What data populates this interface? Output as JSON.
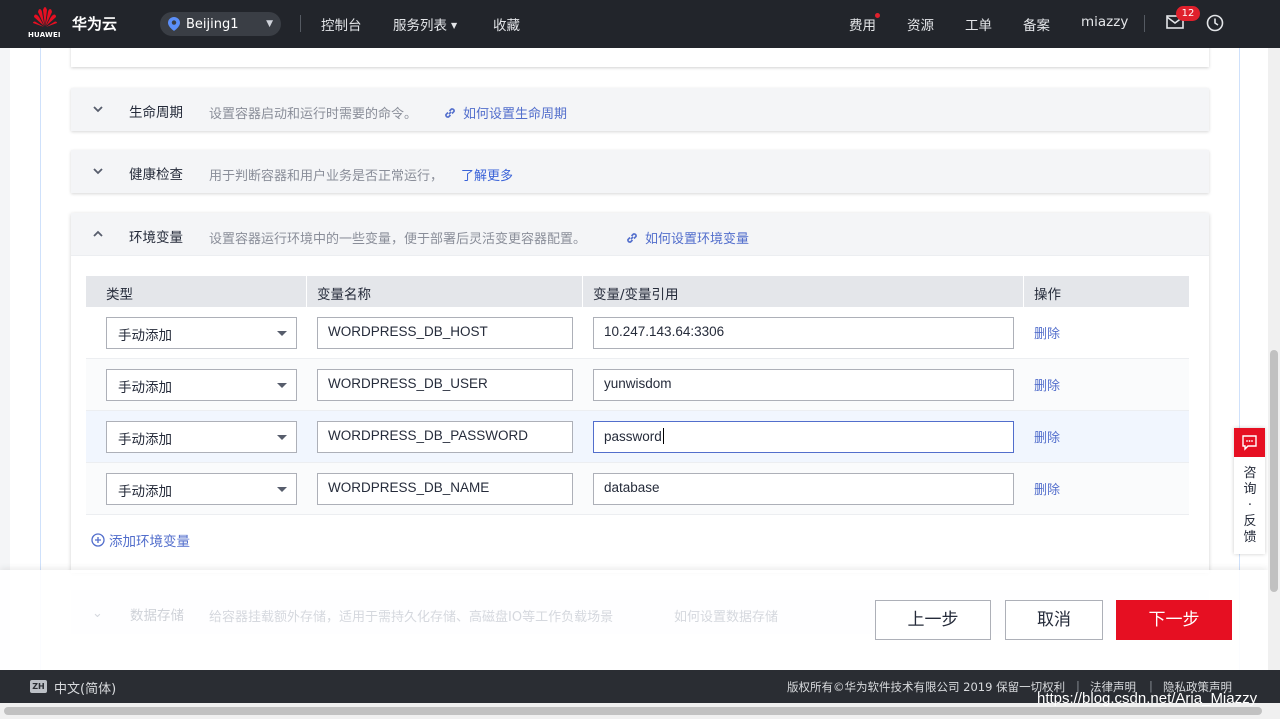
{
  "header": {
    "logo_text": "HUAWEI",
    "brand": "华为云",
    "region": "Beijing1",
    "nav": [
      "控制台",
      "服务列表",
      "收藏"
    ],
    "right_nav": [
      "费用",
      "资源",
      "工单",
      "备案",
      "miazzy"
    ],
    "mail_badge": "12"
  },
  "sections": [
    {
      "title": "生命周期",
      "desc": "设置容器启动和运行时需要的命令。",
      "link": "如何设置生命周期"
    },
    {
      "title": "健康检查",
      "desc": "用于判断容器和用户业务是否正常运行，",
      "link": "了解更多"
    },
    {
      "title": "环境变量",
      "desc": "设置容器运行环境中的一些变量，便于部署后灵活变更容器配置。",
      "link": "如何设置环境变量"
    }
  ],
  "env_table": {
    "headers": [
      "类型",
      "变量名称",
      "变量/变量引用",
      "操作"
    ],
    "rows": [
      {
        "type": "手动添加",
        "name": "WORDPRESS_DB_HOST",
        "value": "10.247.143.64:3306",
        "action": "删除"
      },
      {
        "type": "手动添加",
        "name": "WORDPRESS_DB_USER",
        "value": "yunwisdom",
        "action": "删除"
      },
      {
        "type": "手动添加",
        "name": "WORDPRESS_DB_PASSWORD",
        "value": "password",
        "action": "删除"
      },
      {
        "type": "手动添加",
        "name": "WORDPRESS_DB_NAME",
        "value": "database",
        "action": "删除"
      }
    ],
    "add_label": "添加环境变量"
  },
  "faded_section": {
    "title": "数据存储",
    "desc": "给容器挂载额外存储，适用于需持久化存储、高磁盘IO等工作负载场景",
    "link": "如何设置数据存储"
  },
  "actions": {
    "prev": "上一步",
    "cancel": "取消",
    "next": "下一步"
  },
  "feedback": {
    "text": "咨询·反馈"
  },
  "footer": {
    "lang_icon": "ZH",
    "lang": "中文(简体)",
    "copyright": "版权所有©华为软件技术有限公司 2019 保留一切权利",
    "links": [
      "法律声明",
      "隐私政策声明"
    ]
  },
  "watermark": "https://blog.csdn.net/Aria_Miazzy",
  "colors": {
    "primary": "#e60f22",
    "link": "#526ecc",
    "topbar": "#22252b"
  }
}
